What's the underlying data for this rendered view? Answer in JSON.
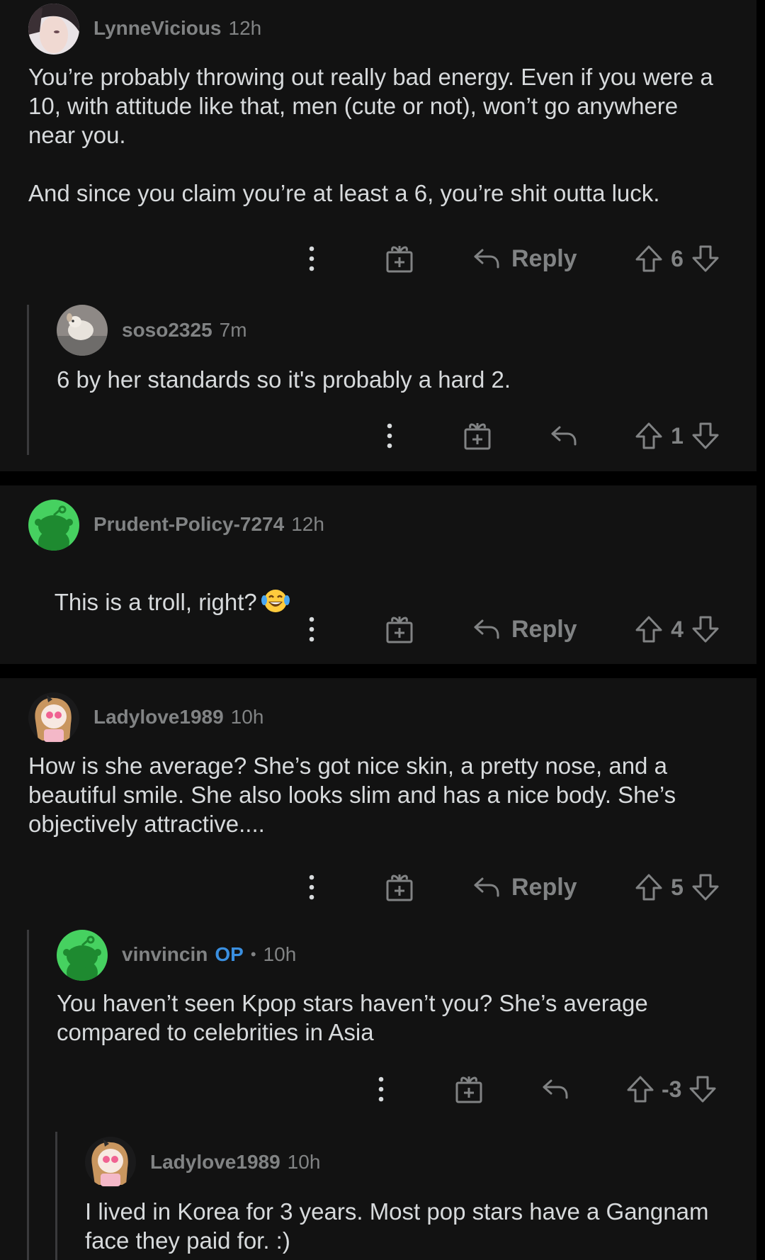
{
  "colors": {
    "background": "#121212",
    "separator": "#000000",
    "muted": "#818384",
    "text": "#d7dadc",
    "op_badge": "#3a8fe0",
    "snoo_green": "#46d160"
  },
  "comments": [
    {
      "user": "LynneVicious",
      "time": "12h",
      "body": "You’re probably throwing out really bad energy. Even if you were a 10, with attitude like that, men (cute or not), won’t go anywhere near you.\n\nAnd since you claim you’re at least a 6, you’re shit outta luck.",
      "reply_label": "Reply",
      "score": "6",
      "avatar": "photo-avatar"
    },
    {
      "user": "soso2325",
      "time": "7m",
      "body": "6 by her standards so it's probably a hard 2.",
      "score": "1",
      "avatar": "dog-photo-avatar"
    },
    {
      "user": "Prudent-Policy-7274",
      "time": "12h",
      "body": "This is a troll, right?",
      "emoji": "laughing-tears-emoji",
      "reply_label": "Reply",
      "score": "4",
      "avatar": "snoo-avatar"
    },
    {
      "user": "Ladylove1989",
      "time": "10h",
      "body": "How is she average? She’s got nice skin, a pretty nose, and a beautiful smile. She also looks slim and has a nice body. She’s objectively attractive....",
      "reply_label": "Reply",
      "score": "5",
      "avatar": "cartoon-girl-avatar"
    },
    {
      "user": "vinvincin",
      "badge": "OP",
      "separator": "•",
      "time": "10h",
      "body": "You haven’t seen Kpop stars haven’t you? She’s average compared to celebrities in Asia",
      "score": "-3",
      "avatar": "snoo-avatar"
    },
    {
      "user": "Ladylove1989",
      "time": "10h",
      "body": "I lived in Korea for 3 years. Most pop stars have a Gangnam face they paid for. :)",
      "avatar": "cartoon-girl-avatar"
    }
  ],
  "icons": {
    "more": "more-options-icon",
    "award": "award-gift-icon",
    "reply": "reply-arrow-icon",
    "upvote": "upvote-arrow-icon",
    "downvote": "downvote-arrow-icon"
  }
}
